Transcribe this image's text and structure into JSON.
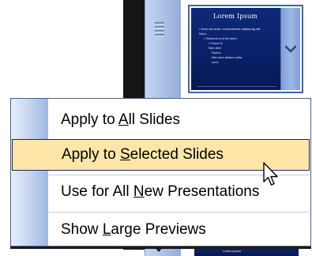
{
  "thumbnail": {
    "title": "Lorem Ipsum",
    "body_lines": [
      "• Dolor sit amet, consectetuer adipiscing elit",
      "  Nunc",
      "  • Vivamus a mi sit amet",
      "    • Fusce id",
      "      Nec nibh",
      "        Donec",
      "        Nec sem dictum nulla",
      "          nunc"
    ],
    "next_thumb_text": "Lorem ipsum"
  },
  "menu": {
    "items": [
      {
        "prefix": "Apply to ",
        "key": "A",
        "suffix": "ll Slides"
      },
      {
        "prefix": "Apply to ",
        "key": "S",
        "suffix": "elected Slides"
      },
      {
        "prefix": "Use for All ",
        "key": "N",
        "suffix": "ew Presentations"
      },
      {
        "prefix": "Show ",
        "key": "L",
        "suffix": "arge Previews"
      }
    ],
    "selected_index": 1
  },
  "colors": {
    "highlight": "#fde6a8",
    "gutter": "#c9d8f1",
    "thumbnail_bg": "#0d2a79"
  },
  "icons": {
    "dropdown": "chevron-down-icon",
    "cursor": "mouse-pointer-icon",
    "scroll_grip": "scroll-grip-icon",
    "scroll_arrow": "scroll-down-arrow-icon"
  }
}
